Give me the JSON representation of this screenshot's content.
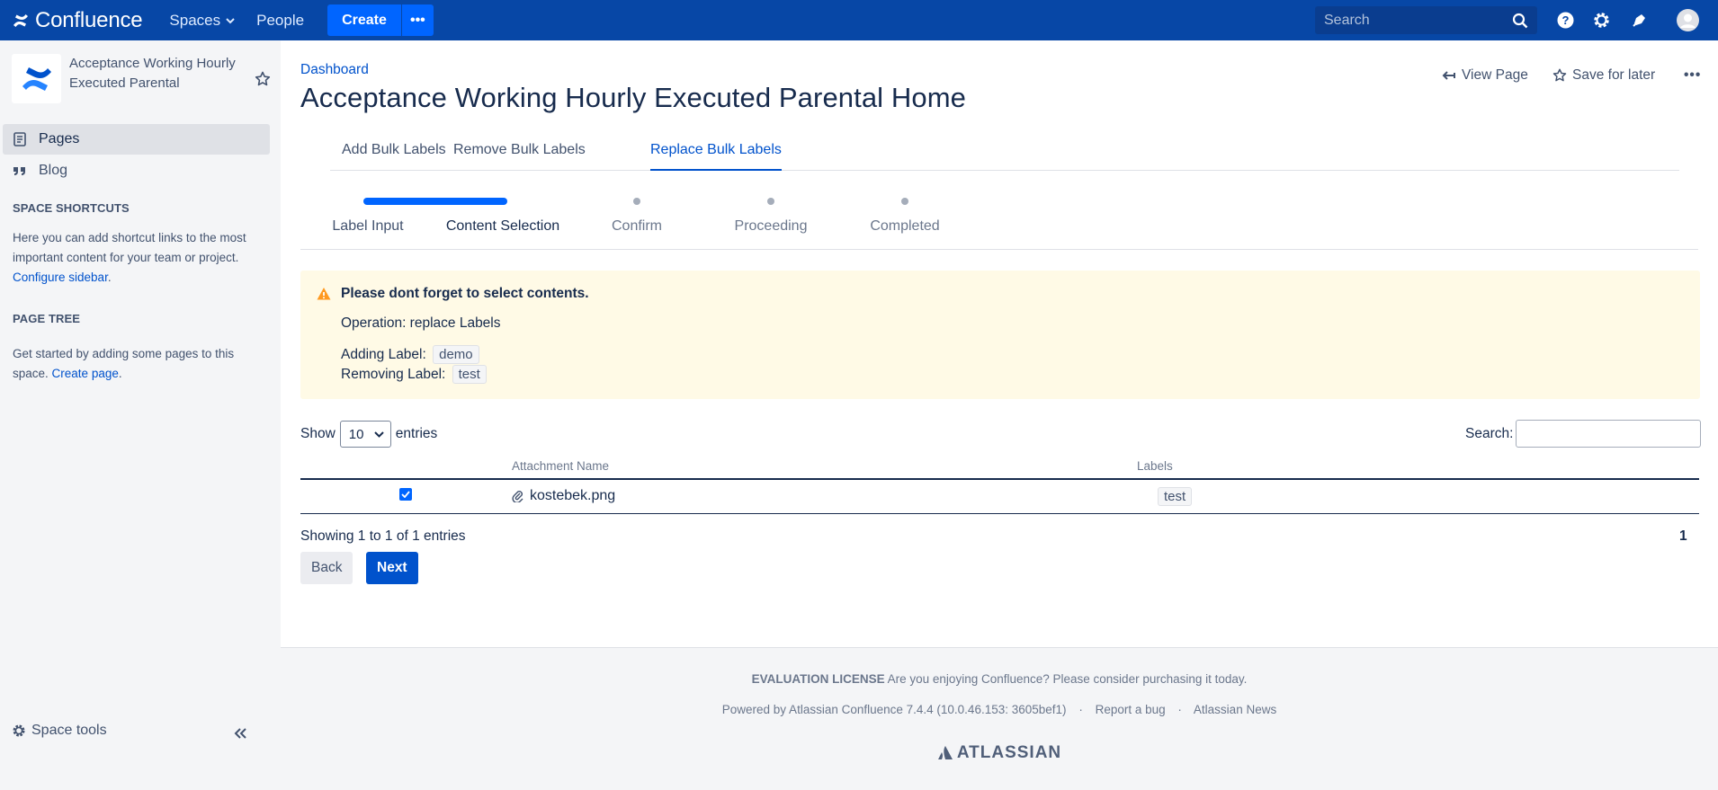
{
  "topnav": {
    "brand": "Confluence",
    "spaces": "Spaces",
    "people": "People",
    "create": "Create",
    "more": "•••",
    "search_placeholder": "Search"
  },
  "sidebar": {
    "space_name": "Acceptance Working Hourly Executed Parental",
    "pages": "Pages",
    "blog": "Blog",
    "shortcuts_heading": "SPACE SHORTCUTS",
    "shortcuts_text": "Here you can add shortcut links to the most important content for your team or project.",
    "configure_link": "Configure sidebar",
    "tree_heading": "PAGE TREE",
    "tree_text": "Get started by adding some pages to this space.",
    "create_page_link": "Create page",
    "space_tools": "Space tools"
  },
  "main": {
    "breadcrumb": "Dashboard",
    "title": "Acceptance Working Hourly Executed Parental Home",
    "view_page": "View Page",
    "save_later": "Save for later",
    "more": "•••",
    "tabs": [
      "Add Bulk Labels",
      "Remove Bulk Labels",
      "Replace Bulk Labels"
    ],
    "steps": [
      "Label Input",
      "Content Selection",
      "Confirm",
      "Proceeding",
      "Completed"
    ],
    "warning": {
      "title": "Please dont forget to select contents.",
      "operation": "Operation: replace Labels",
      "adding_label_prefix": "Adding Label:",
      "adding_label": "demo",
      "removing_label_prefix": "Removing Label:",
      "removing_label": "test"
    },
    "table_ctl": {
      "show": "Show",
      "entries_value": "10",
      "entries": "entries",
      "search": "Search:"
    },
    "table": {
      "headers": [
        "Attachment Name",
        "Labels"
      ],
      "rows": [
        {
          "name": "kostebek.png",
          "label": "test",
          "checked": true
        }
      ]
    },
    "info": "Showing 1 to 1 of 1 entries",
    "page": "1",
    "back": "Back",
    "next": "Next"
  },
  "footer": {
    "license_bold": "EVALUATION LICENSE",
    "license_text": "Are you enjoying Confluence? Please consider purchasing it today.",
    "powered": "Powered by Atlassian Confluence 7.4.4 (10.0.46.153: 3605bef1)",
    "report": "Report a bug",
    "news": "Atlassian News",
    "sep": "·",
    "atlassian": "ATLASSIAN"
  },
  "colors": {
    "nav": "#0747a6",
    "primary": "#0052cc",
    "warning_bg": "#fffae6",
    "warning_icon": "#ff991f"
  }
}
